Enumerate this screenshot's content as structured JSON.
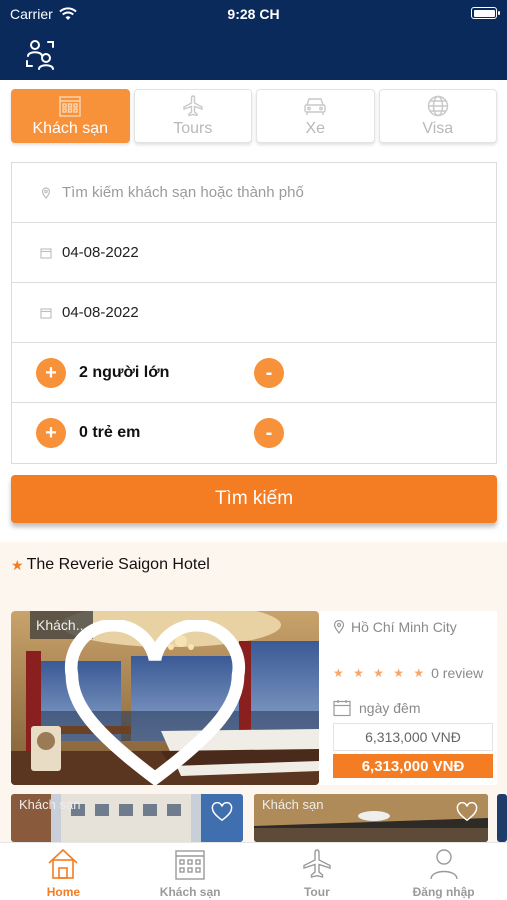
{
  "status": {
    "carrier": "Carrier",
    "time": "9:28 CH"
  },
  "tabs": [
    {
      "label": "Khách sạn",
      "icon": "hotel-icon",
      "active": true
    },
    {
      "label": "Tours",
      "icon": "plane-icon",
      "active": false
    },
    {
      "label": "Xe",
      "icon": "car-icon",
      "active": false
    },
    {
      "label": "Visa",
      "icon": "globe-icon",
      "active": false
    }
  ],
  "search": {
    "location_placeholder": "Tìm kiếm khách sạn hoặc thành phố",
    "checkin_date": "04-08-2022",
    "checkout_date": "04-08-2022",
    "adults_label": "2 người lớn",
    "children_label": "0 trẻ em",
    "plus_symbol": "+",
    "minus_symbol": "-",
    "button_label": "Tìm kiếm"
  },
  "featured": {
    "title": "The Reverie Saigon Hotel",
    "card": {
      "badge": "Khách...",
      "city": "Hồ Chí Minh City",
      "review": "0 review",
      "stars": "★ ★ ★ ★ ★",
      "nights": "ngày  đêm",
      "price_old": "6,313,000 VNĐ",
      "price_new": "6,313,000 VNĐ"
    },
    "more_cards": [
      {
        "badge": "Khách sạn"
      },
      {
        "badge": "Khách sạn"
      }
    ]
  },
  "bottom_nav": [
    {
      "label": "Home",
      "icon": "home-icon",
      "active": true
    },
    {
      "label": "Khách sạn",
      "icon": "hotel-icon",
      "active": false
    },
    {
      "label": "Tour",
      "icon": "plane-icon",
      "active": false
    },
    {
      "label": "Đăng nhập",
      "icon": "user-icon",
      "active": false
    }
  ],
  "colors": {
    "navy": "#0b2a5c",
    "accent": "#f47c22",
    "tab_active": "#f7913a"
  }
}
